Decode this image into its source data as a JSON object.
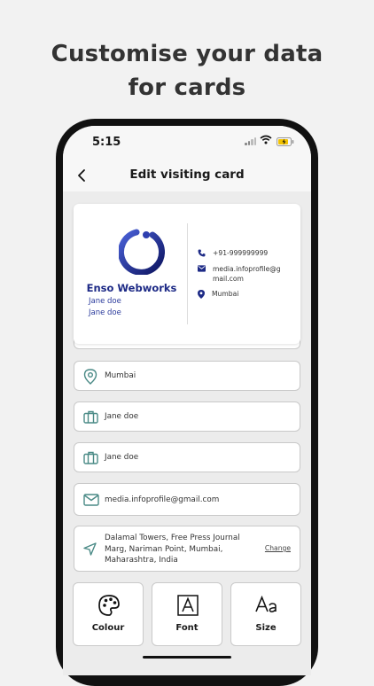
{
  "headline": {
    "line1": "Customise your data",
    "line2": "for cards"
  },
  "status_bar": {
    "time": "5:15"
  },
  "app_bar": {
    "title": "Edit visiting card"
  },
  "card": {
    "company": "Enso Webworks",
    "person_line1": "Jane doe",
    "person_line2": "Jane doe",
    "phone": "+91-999999999",
    "email": "media.infoprofile@gmail.com",
    "location": "Mumbai"
  },
  "fields": {
    "city": "Mumbai",
    "name": "Jane doe",
    "designation": "Jane doe",
    "email": "media.infoprofile@gmail.com",
    "address": "Dalamal Towers, Free Press Journal Marg, Nariman Point, Mumbai, Maharashtra, India",
    "address_action": "Change"
  },
  "options": [
    {
      "label": "Colour",
      "icon": "palette-icon"
    },
    {
      "label": "Font",
      "icon": "font-icon"
    },
    {
      "label": "Size",
      "icon": "text-size-icon"
    }
  ],
  "colors": {
    "brand_navy": "#1d2a86",
    "field_icon_teal": "#4a8a86",
    "background": "#f2f2f2"
  }
}
